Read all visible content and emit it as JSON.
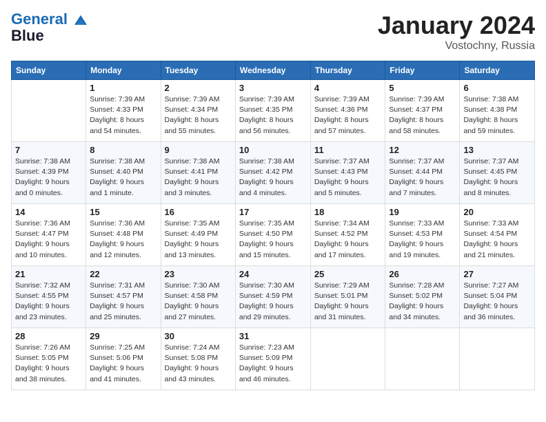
{
  "header": {
    "logo_line1": "General",
    "logo_line2": "Blue",
    "month": "January 2024",
    "location": "Vostochny, Russia"
  },
  "weekdays": [
    "Sunday",
    "Monday",
    "Tuesday",
    "Wednesday",
    "Thursday",
    "Friday",
    "Saturday"
  ],
  "weeks": [
    [
      {
        "day": "",
        "sunrise": "",
        "sunset": "",
        "daylight": ""
      },
      {
        "day": "1",
        "sunrise": "Sunrise: 7:39 AM",
        "sunset": "Sunset: 4:33 PM",
        "daylight": "Daylight: 8 hours and 54 minutes."
      },
      {
        "day": "2",
        "sunrise": "Sunrise: 7:39 AM",
        "sunset": "Sunset: 4:34 PM",
        "daylight": "Daylight: 8 hours and 55 minutes."
      },
      {
        "day": "3",
        "sunrise": "Sunrise: 7:39 AM",
        "sunset": "Sunset: 4:35 PM",
        "daylight": "Daylight: 8 hours and 56 minutes."
      },
      {
        "day": "4",
        "sunrise": "Sunrise: 7:39 AM",
        "sunset": "Sunset: 4:36 PM",
        "daylight": "Daylight: 8 hours and 57 minutes."
      },
      {
        "day": "5",
        "sunrise": "Sunrise: 7:39 AM",
        "sunset": "Sunset: 4:37 PM",
        "daylight": "Daylight: 8 hours and 58 minutes."
      },
      {
        "day": "6",
        "sunrise": "Sunrise: 7:38 AM",
        "sunset": "Sunset: 4:38 PM",
        "daylight": "Daylight: 8 hours and 59 minutes."
      }
    ],
    [
      {
        "day": "7",
        "sunrise": "Sunrise: 7:38 AM",
        "sunset": "Sunset: 4:39 PM",
        "daylight": "Daylight: 9 hours and 0 minutes."
      },
      {
        "day": "8",
        "sunrise": "Sunrise: 7:38 AM",
        "sunset": "Sunset: 4:40 PM",
        "daylight": "Daylight: 9 hours and 1 minute."
      },
      {
        "day": "9",
        "sunrise": "Sunrise: 7:38 AM",
        "sunset": "Sunset: 4:41 PM",
        "daylight": "Daylight: 9 hours and 3 minutes."
      },
      {
        "day": "10",
        "sunrise": "Sunrise: 7:38 AM",
        "sunset": "Sunset: 4:42 PM",
        "daylight": "Daylight: 9 hours and 4 minutes."
      },
      {
        "day": "11",
        "sunrise": "Sunrise: 7:37 AM",
        "sunset": "Sunset: 4:43 PM",
        "daylight": "Daylight: 9 hours and 5 minutes."
      },
      {
        "day": "12",
        "sunrise": "Sunrise: 7:37 AM",
        "sunset": "Sunset: 4:44 PM",
        "daylight": "Daylight: 9 hours and 7 minutes."
      },
      {
        "day": "13",
        "sunrise": "Sunrise: 7:37 AM",
        "sunset": "Sunset: 4:45 PM",
        "daylight": "Daylight: 9 hours and 8 minutes."
      }
    ],
    [
      {
        "day": "14",
        "sunrise": "Sunrise: 7:36 AM",
        "sunset": "Sunset: 4:47 PM",
        "daylight": "Daylight: 9 hours and 10 minutes."
      },
      {
        "day": "15",
        "sunrise": "Sunrise: 7:36 AM",
        "sunset": "Sunset: 4:48 PM",
        "daylight": "Daylight: 9 hours and 12 minutes."
      },
      {
        "day": "16",
        "sunrise": "Sunrise: 7:35 AM",
        "sunset": "Sunset: 4:49 PM",
        "daylight": "Daylight: 9 hours and 13 minutes."
      },
      {
        "day": "17",
        "sunrise": "Sunrise: 7:35 AM",
        "sunset": "Sunset: 4:50 PM",
        "daylight": "Daylight: 9 hours and 15 minutes."
      },
      {
        "day": "18",
        "sunrise": "Sunrise: 7:34 AM",
        "sunset": "Sunset: 4:52 PM",
        "daylight": "Daylight: 9 hours and 17 minutes."
      },
      {
        "day": "19",
        "sunrise": "Sunrise: 7:33 AM",
        "sunset": "Sunset: 4:53 PM",
        "daylight": "Daylight: 9 hours and 19 minutes."
      },
      {
        "day": "20",
        "sunrise": "Sunrise: 7:33 AM",
        "sunset": "Sunset: 4:54 PM",
        "daylight": "Daylight: 9 hours and 21 minutes."
      }
    ],
    [
      {
        "day": "21",
        "sunrise": "Sunrise: 7:32 AM",
        "sunset": "Sunset: 4:55 PM",
        "daylight": "Daylight: 9 hours and 23 minutes."
      },
      {
        "day": "22",
        "sunrise": "Sunrise: 7:31 AM",
        "sunset": "Sunset: 4:57 PM",
        "daylight": "Daylight: 9 hours and 25 minutes."
      },
      {
        "day": "23",
        "sunrise": "Sunrise: 7:30 AM",
        "sunset": "Sunset: 4:58 PM",
        "daylight": "Daylight: 9 hours and 27 minutes."
      },
      {
        "day": "24",
        "sunrise": "Sunrise: 7:30 AM",
        "sunset": "Sunset: 4:59 PM",
        "daylight": "Daylight: 9 hours and 29 minutes."
      },
      {
        "day": "25",
        "sunrise": "Sunrise: 7:29 AM",
        "sunset": "Sunset: 5:01 PM",
        "daylight": "Daylight: 9 hours and 31 minutes."
      },
      {
        "day": "26",
        "sunrise": "Sunrise: 7:28 AM",
        "sunset": "Sunset: 5:02 PM",
        "daylight": "Daylight: 9 hours and 34 minutes."
      },
      {
        "day": "27",
        "sunrise": "Sunrise: 7:27 AM",
        "sunset": "Sunset: 5:04 PM",
        "daylight": "Daylight: 9 hours and 36 minutes."
      }
    ],
    [
      {
        "day": "28",
        "sunrise": "Sunrise: 7:26 AM",
        "sunset": "Sunset: 5:05 PM",
        "daylight": "Daylight: 9 hours and 38 minutes."
      },
      {
        "day": "29",
        "sunrise": "Sunrise: 7:25 AM",
        "sunset": "Sunset: 5:06 PM",
        "daylight": "Daylight: 9 hours and 41 minutes."
      },
      {
        "day": "30",
        "sunrise": "Sunrise: 7:24 AM",
        "sunset": "Sunset: 5:08 PM",
        "daylight": "Daylight: 9 hours and 43 minutes."
      },
      {
        "day": "31",
        "sunrise": "Sunrise: 7:23 AM",
        "sunset": "Sunset: 5:09 PM",
        "daylight": "Daylight: 9 hours and 46 minutes."
      },
      {
        "day": "",
        "sunrise": "",
        "sunset": "",
        "daylight": ""
      },
      {
        "day": "",
        "sunrise": "",
        "sunset": "",
        "daylight": ""
      },
      {
        "day": "",
        "sunrise": "",
        "sunset": "",
        "daylight": ""
      }
    ]
  ]
}
